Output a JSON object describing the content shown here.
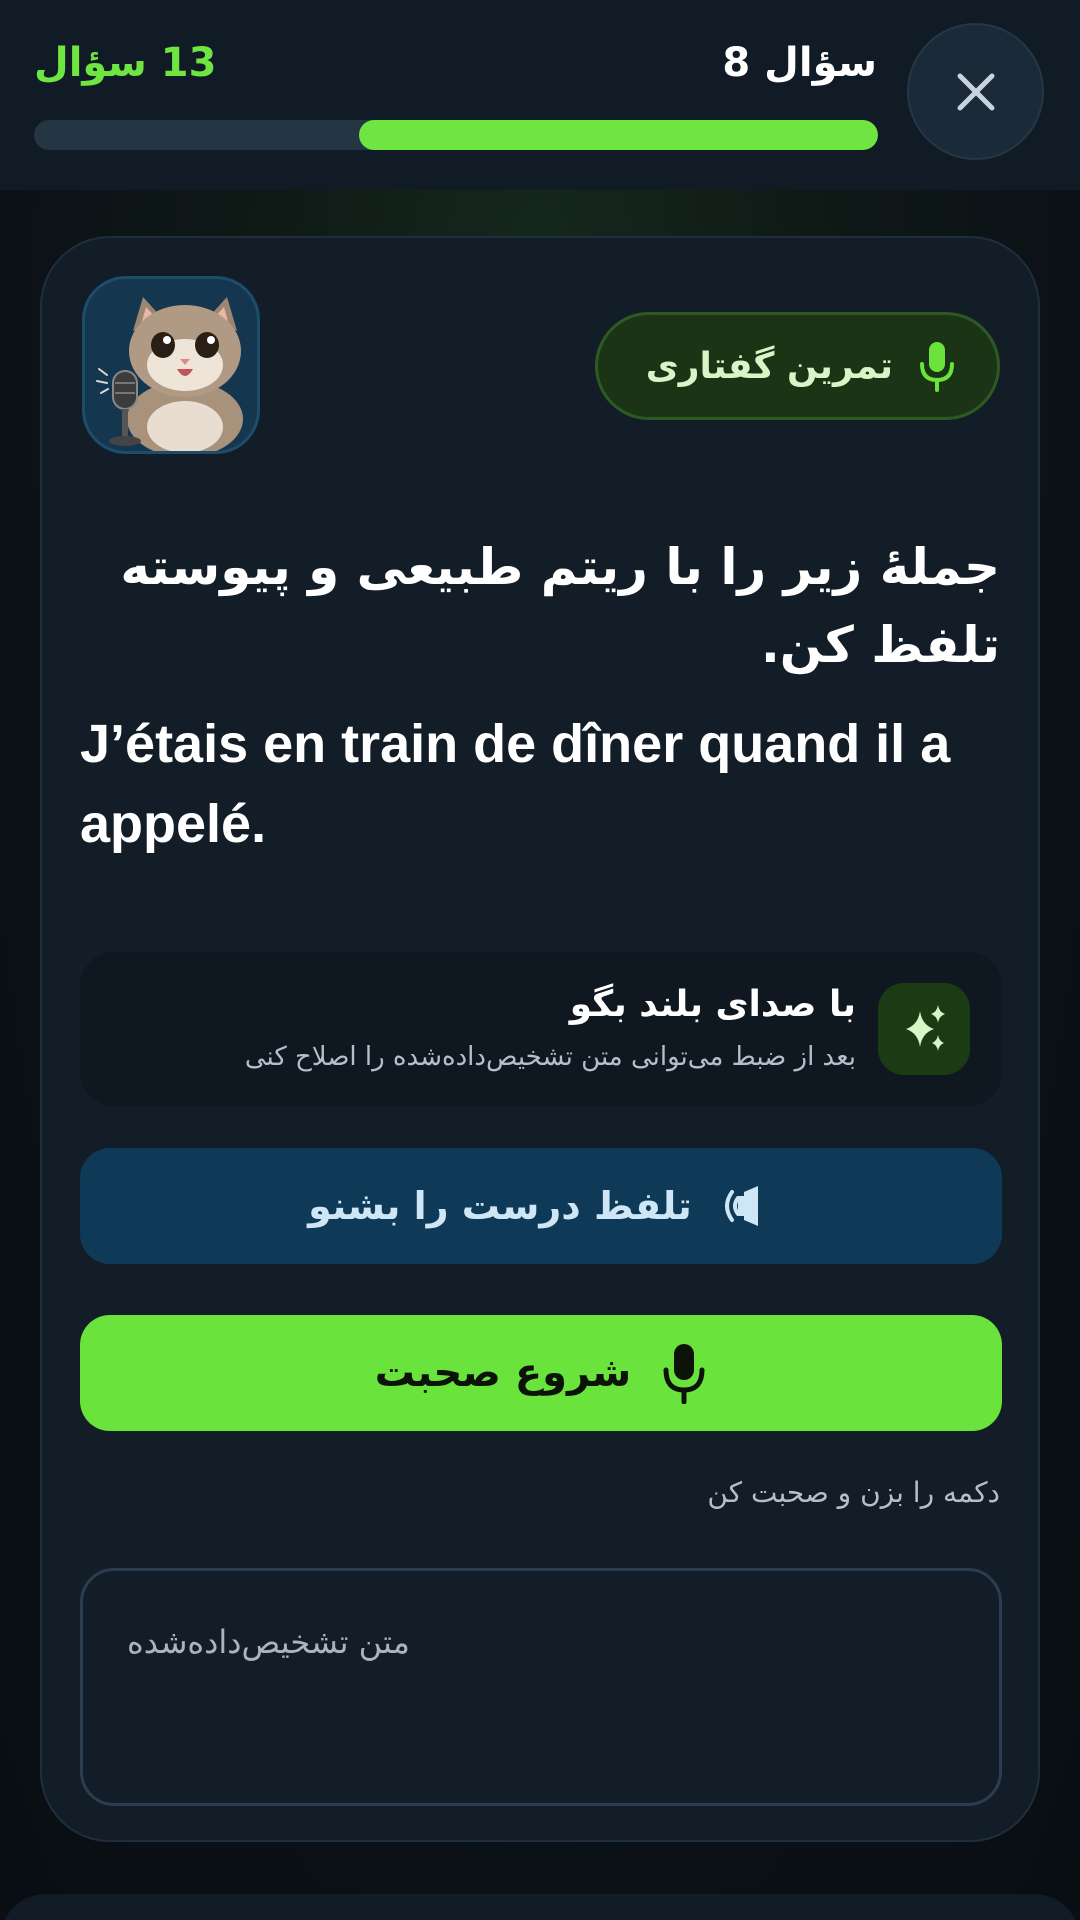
{
  "header": {
    "question_current": "سؤال 8",
    "question_total": "13 سؤال",
    "progress_fraction": 0.615,
    "close_icon": "close-icon"
  },
  "card": {
    "avatar_icon": "cat-microphone-avatar",
    "tag": {
      "label": "تمرین گفتاری",
      "icon": "microphone-icon"
    },
    "instruction": "جملهٔ زیر را با ریتم طبیعی و پیوسته تلفظ کن.",
    "sentence": "J’étais en train de dîner quand il a appelé.",
    "hint": {
      "title": "با صدای بلند بگو",
      "subtitle": "بعد از ضبط می‌توانی متن تشخیص‌داده‌شده را اصلاح کنی",
      "icon": "sparkles-icon"
    },
    "listen_button": {
      "label": "تلفظ درست را بشنو",
      "icon": "speaker-icon"
    },
    "speak_button": {
      "label": "شروع صحبت",
      "icon": "microphone-icon"
    },
    "helper_text": "دکمه را بزن و صحبت کن",
    "transcript": {
      "placeholder": "متن تشخیص‌داده‌شده"
    }
  },
  "colors": {
    "accent_green": "#6ae33d",
    "listen_blue": "#0f3a57",
    "card_bg": "#131d28",
    "header_bg": "#111b25"
  }
}
